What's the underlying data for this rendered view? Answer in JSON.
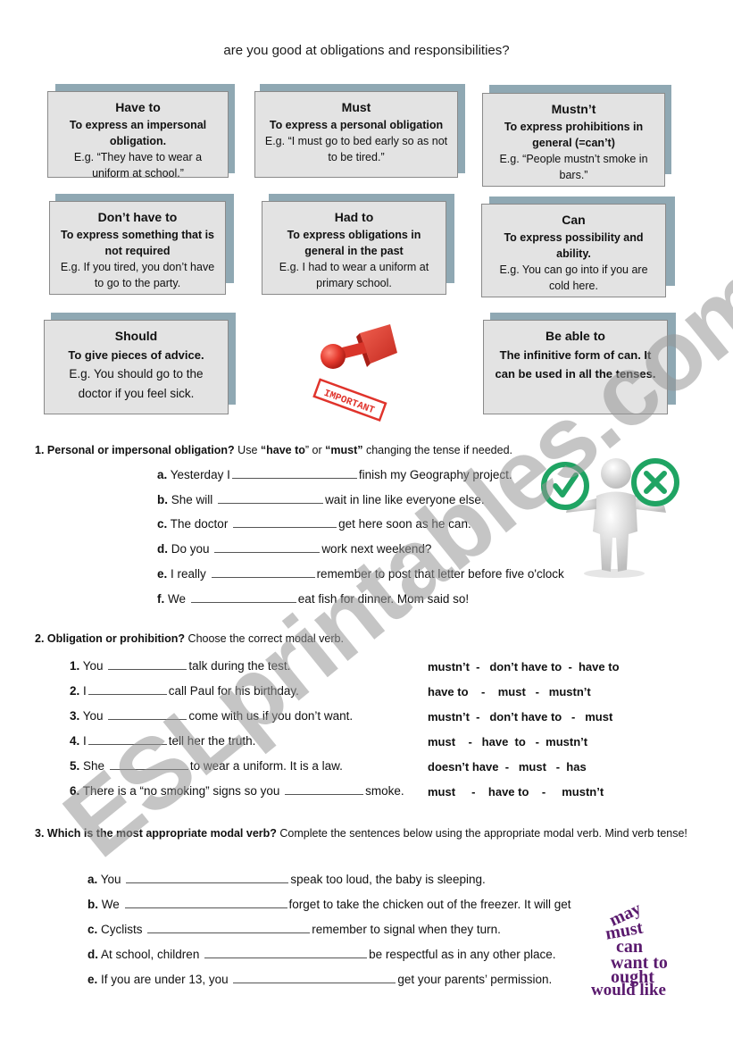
{
  "title": "are you good at obligations and responsibilities?",
  "boxes": [
    {
      "title": "Have to",
      "definition": "To express an impersonal obligation.",
      "example": "E.g. “They have to wear a uniform at school.”"
    },
    {
      "title": "Must",
      "definition": "To express a personal obligation",
      "example": "E.g. “I must go to bed early so as not to be tired.”"
    },
    {
      "title": "Mustn’t",
      "definition": "To express prohibitions in general (=can’t)",
      "example": "E.g. “People mustn’t smoke in bars.”"
    },
    {
      "title": "Don’t have to",
      "definition": "To express something that is not required",
      "example": "E.g. If you tired, you don’t have to go to the party."
    },
    {
      "title": "Had to",
      "definition": "To express obligations in general in the past",
      "example": "E.g. I had to wear a uniform at primary school."
    },
    {
      "title": "Can",
      "definition": "To express possibility and ability.",
      "example": "E.g. You can go into if you are cold here."
    },
    {
      "title": "Should",
      "definition": "To give pieces of advice.",
      "example": "E.g. You should go to the doctor if you feel sick."
    },
    {
      "title": "Be able to",
      "definition": "The infinitive form of can. It can be used in all the tenses.",
      "example": ""
    }
  ],
  "stamp": {
    "label": "IMPORTANT",
    "icon": "rubber-stamp-icon",
    "color": "#e0332b"
  },
  "figure": {
    "icon": "person-check-cross-icon",
    "accent": "#1fa463"
  },
  "exercise1": {
    "number": "1.",
    "heading_bold": "Personal or impersonal obligation?",
    "heading_rest_1": " Use ",
    "opt1": "“have to",
    "q_mid": "” or ",
    "opt2": "“must”",
    "heading_rest_2": " changing the tense if needed.",
    "items": [
      {
        "label": "a.",
        "before": "Yesterday I",
        "after": "finish my Geography project."
      },
      {
        "label": "b.",
        "before": "She will",
        "after": "wait in line like everyone else."
      },
      {
        "label": "c.",
        "before": "The doctor",
        "after": "get here soon as he can."
      },
      {
        "label": "d.",
        "before": "Do you",
        "after": "work next weekend?"
      },
      {
        "label": "e.",
        "before": "I really",
        "after": "remember to post that letter before five o'clock"
      },
      {
        "label": "f.",
        "before": "We",
        "after": "eat fish for dinner. Mom said so!"
      }
    ]
  },
  "exercise2": {
    "number": "2.",
    "heading_bold": "Obligation or prohibition?",
    "heading_rest": " Choose the correct modal verb.",
    "items": [
      {
        "label": "1.",
        "before": "You",
        "after": "talk during the test.",
        "choices": "mustn’t  -   don’t have to  -  have to"
      },
      {
        "label": "2.",
        "before": "I",
        "after": "call Paul for his birthday.",
        "choices": "have to    -    must   -   mustn’t"
      },
      {
        "label": "3.",
        "before": "You",
        "after": "come with us if you don’t want.",
        "choices": "mustn’t  -   don’t have to   -   must"
      },
      {
        "label": "4.",
        "before": "I",
        "after": "tell her the truth.",
        "choices": "must    -   have  to   -  mustn’t"
      },
      {
        "label": "5.",
        "before": "She",
        "after": "to wear a uniform. It is a law.",
        "choices": "doesn’t have  -   must   -  has"
      },
      {
        "label": "6.",
        "before": "There is a “no smoking” signs so you",
        "after": "smoke.",
        "choices": "must     -    have to    -     mustn’t"
      }
    ]
  },
  "exercise3": {
    "number": "3.",
    "heading_bold": "Which is the most appropriate modal verb?",
    "heading_rest": " Complete the sentences below using the appropriate modal verb. Mind verb tense!",
    "items": [
      {
        "label": "a.",
        "before": "You",
        "after": "speak too loud, the baby is sleeping."
      },
      {
        "label": "b.",
        "before": "We",
        "after": "forget to take the chicken out of the freezer. It will get"
      },
      {
        "label": "c.",
        "before": "Cyclists",
        "after": "remember to signal when they turn."
      },
      {
        "label": "d.",
        "before": "At school, children",
        "after": "be respectful as in any other place."
      },
      {
        "label": "e.",
        "before": "If you are under 13, you",
        "after": "get your parents’ permission."
      }
    ]
  },
  "modal_cloud": {
    "words": [
      "may",
      "must",
      "can",
      "want to",
      "ought",
      "would like"
    ],
    "color": "#5a1a6e"
  },
  "watermark": "ESLprintables.com"
}
